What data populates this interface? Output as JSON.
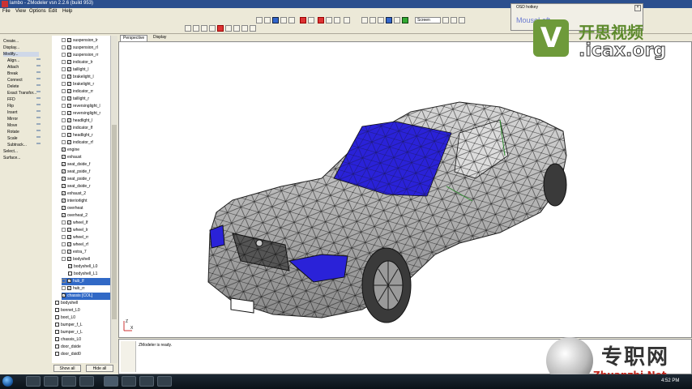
{
  "app": {
    "title": "lambo - ZModeler vsn 2.2.6 (build 953)"
  },
  "menu": [
    "File",
    "View",
    "Options",
    "Edit",
    "Help"
  ],
  "toolbar": {
    "view_mode": "Screen"
  },
  "commands": [
    "Create...",
    "Display...",
    "Modify...",
    "Align...",
    "Attach",
    "Break",
    "Connect",
    "Delete",
    "Exact Transfor...",
    "FFD",
    "Flip",
    "Insert",
    "Mirror",
    "Move",
    "Rotate",
    "Scale",
    "Subtrack...",
    "Select...",
    "Surface..."
  ],
  "tree": [
    {
      "label": "suspension_lr",
      "checked": true,
      "indent": 1,
      "expander": true
    },
    {
      "label": "suspension_rl",
      "checked": true,
      "indent": 1,
      "expander": true
    },
    {
      "label": "suspension_rr",
      "checked": true,
      "indent": 1,
      "expander": true
    },
    {
      "label": "indicator_lr",
      "checked": true,
      "indent": 1,
      "expander": true
    },
    {
      "label": "taillight_l",
      "checked": true,
      "indent": 1,
      "expander": true
    },
    {
      "label": "brakelight_l",
      "checked": true,
      "indent": 1,
      "expander": true
    },
    {
      "label": "brakelight_r",
      "checked": true,
      "indent": 1,
      "expander": true
    },
    {
      "label": "indicator_rr",
      "checked": true,
      "indent": 1,
      "expander": true
    },
    {
      "label": "taillight_r",
      "checked": true,
      "indent": 1,
      "expander": true
    },
    {
      "label": "reversinglight_l",
      "checked": true,
      "indent": 1,
      "expander": true
    },
    {
      "label": "reversinglight_r",
      "checked": true,
      "indent": 1,
      "expander": true
    },
    {
      "label": "headlight_l",
      "checked": true,
      "indent": 1,
      "expander": true
    },
    {
      "label": "indicator_lf",
      "checked": true,
      "indent": 1,
      "expander": true
    },
    {
      "label": "headlight_r",
      "checked": true,
      "indent": 1,
      "expander": true
    },
    {
      "label": "indicator_rf",
      "checked": true,
      "indent": 1,
      "expander": true
    },
    {
      "label": "engine",
      "checked": true,
      "indent": 1,
      "expander": false
    },
    {
      "label": "exhaust",
      "checked": true,
      "indent": 1,
      "expander": false
    },
    {
      "label": "seat_dside_f",
      "checked": true,
      "indent": 1,
      "expander": false
    },
    {
      "label": "seat_pside_f",
      "checked": true,
      "indent": 1,
      "expander": false
    },
    {
      "label": "seat_pside_r",
      "checked": true,
      "indent": 1,
      "expander": false
    },
    {
      "label": "seat_dside_r",
      "checked": true,
      "indent": 1,
      "expander": false
    },
    {
      "label": "exhaust_2",
      "checked": true,
      "indent": 1,
      "expander": false
    },
    {
      "label": "interiorlight",
      "checked": true,
      "indent": 1,
      "expander": false
    },
    {
      "label": "overheat",
      "checked": true,
      "indent": 1,
      "expander": false
    },
    {
      "label": "overheat_2",
      "checked": true,
      "indent": 1,
      "expander": false
    },
    {
      "label": "wheel_lf",
      "checked": true,
      "indent": 1,
      "expander": true
    },
    {
      "label": "wheel_lr",
      "checked": true,
      "indent": 1,
      "expander": true
    },
    {
      "label": "wheel_rr",
      "checked": true,
      "indent": 1,
      "expander": true
    },
    {
      "label": "wheel_rf",
      "checked": true,
      "indent": 1,
      "expander": true
    },
    {
      "label": "extra_7",
      "checked": true,
      "indent": 1,
      "expander": true
    },
    {
      "label": "bodyshell",
      "checked": true,
      "indent": 1,
      "expander": true
    },
    {
      "label": "bodyshell_L0",
      "checked": true,
      "indent": 2,
      "expander": false
    },
    {
      "label": "bodyshell_L1",
      "checked": false,
      "indent": 2,
      "expander": false
    },
    {
      "label": "hub_lf",
      "checked": true,
      "indent": 1,
      "expander": true,
      "selected": true
    },
    {
      "label": "hub_rr",
      "checked": true,
      "indent": 1,
      "expander": true
    },
    {
      "label": "chassis [COL]",
      "checked": true,
      "indent": 1,
      "expander": false,
      "selected": true
    },
    {
      "label": "bodyshell",
      "checked": false,
      "indent": 0,
      "expander": false
    },
    {
      "label": "bonnet_L0",
      "checked": false,
      "indent": 0,
      "expander": false
    },
    {
      "label": "boot_L0",
      "checked": false,
      "indent": 0,
      "expander": false
    },
    {
      "label": "bumper_f_L",
      "checked": false,
      "indent": 0,
      "expander": false
    },
    {
      "label": "bumper_r_L",
      "checked": false,
      "indent": 0,
      "expander": false
    },
    {
      "label": "chassis_L0",
      "checked": false,
      "indent": 0,
      "expander": false
    },
    {
      "label": "door_dside",
      "checked": false,
      "indent": 0,
      "expander": false
    },
    {
      "label": "door_dsid0",
      "checked": false,
      "indent": 0,
      "expander": false
    }
  ],
  "tree_buttons": {
    "show_all": "Show all",
    "hide_all": "Hide all"
  },
  "viewport": {
    "tab_perspective": "Perspective",
    "tab_display": "Display",
    "axis_x": "X",
    "axis_y": "Y",
    "axis_z": "Z"
  },
  "console": {
    "message": "ZModeler is ready."
  },
  "osd": {
    "title": "OSD hotkey",
    "text": "MouseLeft"
  },
  "watermark_top": {
    "letter": "V",
    "cn": "开思视频",
    "url": ".icax.org"
  },
  "watermark_bottom": {
    "cn": "专职网",
    "url": "Zhuanzhi.Net"
  },
  "clock": "4:52 PM",
  "colors": {
    "titlebar": "#2b4f8e",
    "mesh_blue": "#2a22d8",
    "selection": "#3169c6"
  }
}
